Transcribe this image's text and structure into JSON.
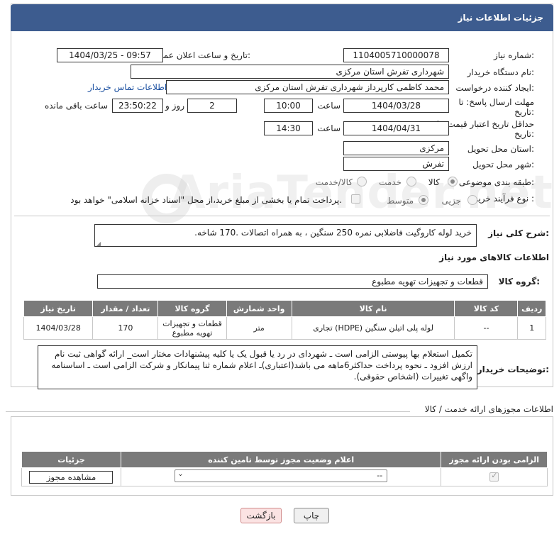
{
  "header": {
    "title": "جزئیات اطلاعات نیاز"
  },
  "form": {
    "need_number_label": "شماره نیاز:",
    "need_number": "1104005710000078",
    "announce_label": "تاریخ و ساعت اعلان عمومی:",
    "announce_value": "1404/03/25 - 09:57",
    "buyer_org_label": "نام دستگاه خریدار:",
    "buyer_org": "شهرداری تفرش استان مرکزی",
    "creator_label": "ایجاد کننده درخواست:",
    "creator": "محمد کاظمی کارپرداز شهرداری تفرش استان مرکزی",
    "contact_link": "اطلاعات تماس خریدار",
    "deadline_label": "مهلت ارسال پاسخ: تا تاریخ:",
    "deadline_date": "1404/03/28",
    "time_label": "ساعت",
    "deadline_time": "10:00",
    "days_value": "2",
    "days_label": "روز و",
    "remaining_time": "23:50:22",
    "remaining_label": "ساعت باقی مانده",
    "price_validity_label": "حداقل تاریخ اعتبار قیمت: تا تاریخ:",
    "price_validity_date": "1404/04/31",
    "price_validity_time": "14:30",
    "province_label": "استان محل تحویل:",
    "province": "مرکزی",
    "city_label": "شهر محل تحویل:",
    "city": "تفرش",
    "category_label": "طبقه بندی موضوعی:",
    "category_options": [
      "کالا",
      "خدمت",
      "کالا/خدمت"
    ],
    "purchase_type_label": "نوع فرآیند خرید :",
    "purchase_options": [
      "جزیی",
      "متوسط"
    ],
    "payment_note": "پرداخت تمام یا بخشی از مبلغ خرید،از محل \"اسناد خزانه اسلامی\" خواهد بود."
  },
  "description": {
    "label": "شرح کلی نیاز:",
    "text": "خرید لوله کاروگیت فاضلابی نمره 250 سنگین ، به همراه اتصالات .170 شاخه."
  },
  "goods": {
    "section_title": "اطلاعات کالاهای مورد نیاز",
    "group_label": "گروه کالا:",
    "group_value": "قطعات و تجهیزات تهویه مطبوع",
    "columns": [
      "ردیف",
      "کد کالا",
      "نام کالا",
      "واحد شمارش",
      "گروه کالا",
      "تعداد / مقدار",
      "تاریخ نیاز"
    ],
    "rows": [
      {
        "row": "1",
        "code": "--",
        "name": "لوله پلی اتیلن سنگین (HDPE) تجاری",
        "unit": "متر",
        "group": "قطعات و تجهیزات تهویه مطبوع",
        "qty": "170",
        "date": "1404/03/28"
      }
    ]
  },
  "buyer_notes": {
    "label": "توضیحات خریدار:",
    "text": "تکمیل استعلام بها پیوستی الزامی است ـ شهردای در رد یا قبول یک یا کلیه پیشنهادات مختار است_ ارائه گواهی ثبت نام ارزش افزود ـ نحوه پرداخت حداکثر6ماهه می باشد(اعتباری)ـ اعلام شماره ثنا پیمانکار و شرکت الزامی است ـ اساسنامه واگهی تغییرات (اشخاص حقوقی)."
  },
  "permits": {
    "section_title": "اطلاعات مجوزهای ارائه خدمت / کالا",
    "columns": [
      "الزامی بودن ارائه مجوز",
      "اعلام وضعیت مجوز توسط تامین کننده",
      "جزئیات"
    ],
    "select_value": "--",
    "view_button": "مشاهده مجوز"
  },
  "footer": {
    "print_button": "چاپ",
    "back_button": "بازگشت"
  },
  "watermark": "AriaTender.net"
}
